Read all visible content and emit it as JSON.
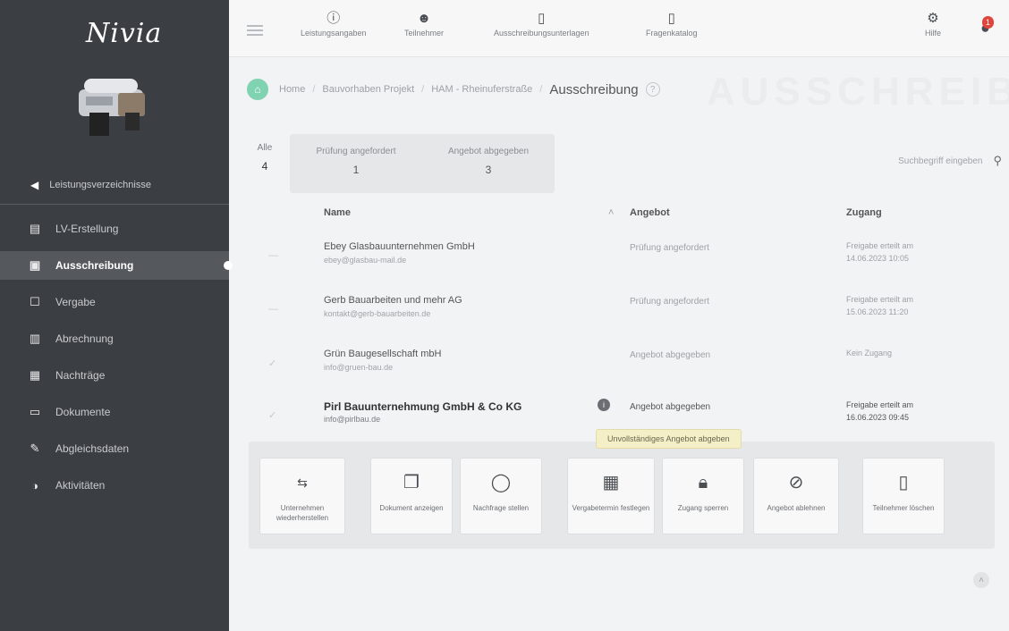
{
  "app": {
    "logo": "Nivia"
  },
  "sidebar": {
    "back_label": "Leistungsverzeichnisse",
    "items": [
      {
        "label": "LV-Erstellung",
        "icon": "document-list-icon",
        "active": false
      },
      {
        "label": "Ausschreibung",
        "icon": "tender-icon",
        "active": true
      },
      {
        "label": "Vergabe",
        "icon": "award-icon",
        "active": false
      },
      {
        "label": "Abrechnung",
        "icon": "billing-icon",
        "active": false
      },
      {
        "label": "Nachträge",
        "icon": "addendum-icon",
        "active": false
      },
      {
        "label": "Dokumente",
        "icon": "documents-icon",
        "active": false
      },
      {
        "label": "Abgleichsdaten",
        "icon": "pen-icon",
        "active": false
      },
      {
        "label": "Aktivitäten",
        "icon": "activity-icon",
        "active": false
      }
    ]
  },
  "topbar": {
    "items": [
      {
        "label": "Leistungsangaben",
        "icon": "info-icon"
      },
      {
        "label": "Teilnehmer",
        "icon": "person-icon"
      },
      {
        "label": "Ausschreibungsunterlagen",
        "icon": "clipboard-icon"
      },
      {
        "label": "Fragenkatalog",
        "icon": "clipboard-question-icon"
      }
    ],
    "help_label": "Hilfe",
    "notifications_count": "1"
  },
  "breadcrumb": {
    "items": [
      "Home",
      "Bauvorhaben Projekt",
      "HAM - Rheinuferstraße"
    ],
    "current": "Ausschreibung",
    "watermark": "AUSSCHREIBUNG"
  },
  "filters": {
    "all_label": "Alle",
    "all_count": "4",
    "columns": [
      {
        "label": "Prüfung angefordert",
        "count": "1"
      },
      {
        "label": "Angebot abgegeben",
        "count": "3"
      }
    ]
  },
  "search": {
    "placeholder": "Suchbegriff eingeben"
  },
  "table": {
    "headers": {
      "name": "Name",
      "status": "Angebot",
      "access": "Zugang"
    },
    "rows": [
      {
        "name": "Ebey Glasbauunternehmen GmbH",
        "email": "ebey@glasbau-mail.de",
        "status": "Prüfung angefordert",
        "access1": "Freigabe erteilt am",
        "access2": "14.06.2023 10:05",
        "selected": false
      },
      {
        "name": "Gerb Bauarbeiten und mehr AG",
        "email": "kontakt@gerb-bauarbeiten.de",
        "status": "Prüfung angefordert",
        "access1": "Freigabe erteilt am",
        "access2": "15.06.2023 11:20",
        "selected": false
      },
      {
        "name": "Grün Baugesellschaft mbH",
        "email": "info@gruen-bau.de",
        "status": "Angebot abgegeben",
        "access1": "Kein Zugang",
        "access2": "",
        "selected": false
      },
      {
        "name": "Pirl Bauunternehmung GmbH & Co KG",
        "email": "info@pirlbau.de",
        "status": "Angebot abgegeben",
        "access1": "Freigabe erteilt am",
        "access2": "16.06.2023 09:45",
        "selected": true
      }
    ]
  },
  "tooltip": "Unvollständiges Angebot abgeben",
  "actions": [
    {
      "label": "Unternehmen wiederherstellen",
      "icon": "restore-icon"
    },
    {
      "label": "Dokument anzeigen",
      "icon": "document-icon"
    },
    {
      "label": "Nachfrage stellen",
      "icon": "chat-bubble-icon"
    },
    {
      "label": "Vergabetermin festlegen",
      "icon": "calendar-icon"
    },
    {
      "label": "Zugang sperren",
      "icon": "lock-icon"
    },
    {
      "label": "Angebot ablehnen",
      "icon": "block-icon"
    },
    {
      "label": "Teilnehmer löschen",
      "icon": "trash-icon"
    }
  ],
  "colors": {
    "sidebar_bg": "#3b3f44",
    "accent_green": "#7fd3b0",
    "badge_red": "#e0443a"
  }
}
